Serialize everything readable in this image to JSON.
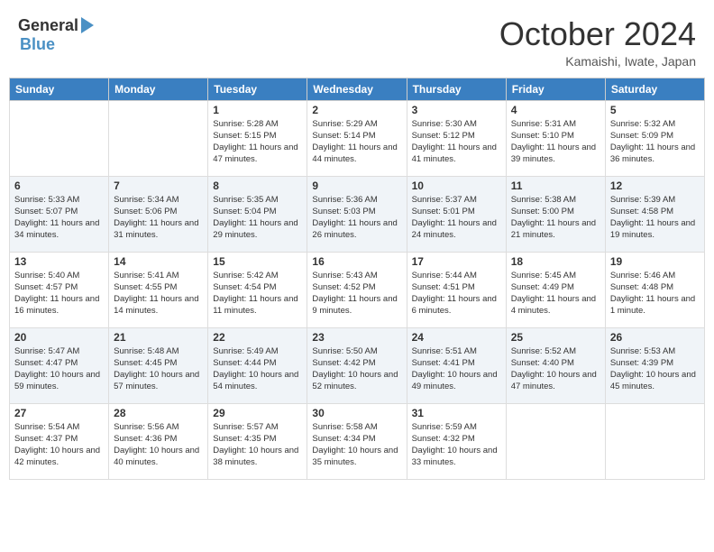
{
  "header": {
    "logo_general": "General",
    "logo_blue": "Blue",
    "month_title": "October 2024",
    "location": "Kamaishi, Iwate, Japan"
  },
  "days_of_week": [
    "Sunday",
    "Monday",
    "Tuesday",
    "Wednesday",
    "Thursday",
    "Friday",
    "Saturday"
  ],
  "weeks": [
    [
      null,
      null,
      {
        "day": "1",
        "sunrise": "Sunrise: 5:28 AM",
        "sunset": "Sunset: 5:15 PM",
        "daylight": "Daylight: 11 hours and 47 minutes."
      },
      {
        "day": "2",
        "sunrise": "Sunrise: 5:29 AM",
        "sunset": "Sunset: 5:14 PM",
        "daylight": "Daylight: 11 hours and 44 minutes."
      },
      {
        "day": "3",
        "sunrise": "Sunrise: 5:30 AM",
        "sunset": "Sunset: 5:12 PM",
        "daylight": "Daylight: 11 hours and 41 minutes."
      },
      {
        "day": "4",
        "sunrise": "Sunrise: 5:31 AM",
        "sunset": "Sunset: 5:10 PM",
        "daylight": "Daylight: 11 hours and 39 minutes."
      },
      {
        "day": "5",
        "sunrise": "Sunrise: 5:32 AM",
        "sunset": "Sunset: 5:09 PM",
        "daylight": "Daylight: 11 hours and 36 minutes."
      }
    ],
    [
      {
        "day": "6",
        "sunrise": "Sunrise: 5:33 AM",
        "sunset": "Sunset: 5:07 PM",
        "daylight": "Daylight: 11 hours and 34 minutes."
      },
      {
        "day": "7",
        "sunrise": "Sunrise: 5:34 AM",
        "sunset": "Sunset: 5:06 PM",
        "daylight": "Daylight: 11 hours and 31 minutes."
      },
      {
        "day": "8",
        "sunrise": "Sunrise: 5:35 AM",
        "sunset": "Sunset: 5:04 PM",
        "daylight": "Daylight: 11 hours and 29 minutes."
      },
      {
        "day": "9",
        "sunrise": "Sunrise: 5:36 AM",
        "sunset": "Sunset: 5:03 PM",
        "daylight": "Daylight: 11 hours and 26 minutes."
      },
      {
        "day": "10",
        "sunrise": "Sunrise: 5:37 AM",
        "sunset": "Sunset: 5:01 PM",
        "daylight": "Daylight: 11 hours and 24 minutes."
      },
      {
        "day": "11",
        "sunrise": "Sunrise: 5:38 AM",
        "sunset": "Sunset: 5:00 PM",
        "daylight": "Daylight: 11 hours and 21 minutes."
      },
      {
        "day": "12",
        "sunrise": "Sunrise: 5:39 AM",
        "sunset": "Sunset: 4:58 PM",
        "daylight": "Daylight: 11 hours and 19 minutes."
      }
    ],
    [
      {
        "day": "13",
        "sunrise": "Sunrise: 5:40 AM",
        "sunset": "Sunset: 4:57 PM",
        "daylight": "Daylight: 11 hours and 16 minutes."
      },
      {
        "day": "14",
        "sunrise": "Sunrise: 5:41 AM",
        "sunset": "Sunset: 4:55 PM",
        "daylight": "Daylight: 11 hours and 14 minutes."
      },
      {
        "day": "15",
        "sunrise": "Sunrise: 5:42 AM",
        "sunset": "Sunset: 4:54 PM",
        "daylight": "Daylight: 11 hours and 11 minutes."
      },
      {
        "day": "16",
        "sunrise": "Sunrise: 5:43 AM",
        "sunset": "Sunset: 4:52 PM",
        "daylight": "Daylight: 11 hours and 9 minutes."
      },
      {
        "day": "17",
        "sunrise": "Sunrise: 5:44 AM",
        "sunset": "Sunset: 4:51 PM",
        "daylight": "Daylight: 11 hours and 6 minutes."
      },
      {
        "day": "18",
        "sunrise": "Sunrise: 5:45 AM",
        "sunset": "Sunset: 4:49 PM",
        "daylight": "Daylight: 11 hours and 4 minutes."
      },
      {
        "day": "19",
        "sunrise": "Sunrise: 5:46 AM",
        "sunset": "Sunset: 4:48 PM",
        "daylight": "Daylight: 11 hours and 1 minute."
      }
    ],
    [
      {
        "day": "20",
        "sunrise": "Sunrise: 5:47 AM",
        "sunset": "Sunset: 4:47 PM",
        "daylight": "Daylight: 10 hours and 59 minutes."
      },
      {
        "day": "21",
        "sunrise": "Sunrise: 5:48 AM",
        "sunset": "Sunset: 4:45 PM",
        "daylight": "Daylight: 10 hours and 57 minutes."
      },
      {
        "day": "22",
        "sunrise": "Sunrise: 5:49 AM",
        "sunset": "Sunset: 4:44 PM",
        "daylight": "Daylight: 10 hours and 54 minutes."
      },
      {
        "day": "23",
        "sunrise": "Sunrise: 5:50 AM",
        "sunset": "Sunset: 4:42 PM",
        "daylight": "Daylight: 10 hours and 52 minutes."
      },
      {
        "day": "24",
        "sunrise": "Sunrise: 5:51 AM",
        "sunset": "Sunset: 4:41 PM",
        "daylight": "Daylight: 10 hours and 49 minutes."
      },
      {
        "day": "25",
        "sunrise": "Sunrise: 5:52 AM",
        "sunset": "Sunset: 4:40 PM",
        "daylight": "Daylight: 10 hours and 47 minutes."
      },
      {
        "day": "26",
        "sunrise": "Sunrise: 5:53 AM",
        "sunset": "Sunset: 4:39 PM",
        "daylight": "Daylight: 10 hours and 45 minutes."
      }
    ],
    [
      {
        "day": "27",
        "sunrise": "Sunrise: 5:54 AM",
        "sunset": "Sunset: 4:37 PM",
        "daylight": "Daylight: 10 hours and 42 minutes."
      },
      {
        "day": "28",
        "sunrise": "Sunrise: 5:56 AM",
        "sunset": "Sunset: 4:36 PM",
        "daylight": "Daylight: 10 hours and 40 minutes."
      },
      {
        "day": "29",
        "sunrise": "Sunrise: 5:57 AM",
        "sunset": "Sunset: 4:35 PM",
        "daylight": "Daylight: 10 hours and 38 minutes."
      },
      {
        "day": "30",
        "sunrise": "Sunrise: 5:58 AM",
        "sunset": "Sunset: 4:34 PM",
        "daylight": "Daylight: 10 hours and 35 minutes."
      },
      {
        "day": "31",
        "sunrise": "Sunrise: 5:59 AM",
        "sunset": "Sunset: 4:32 PM",
        "daylight": "Daylight: 10 hours and 33 minutes."
      },
      null,
      null
    ]
  ]
}
